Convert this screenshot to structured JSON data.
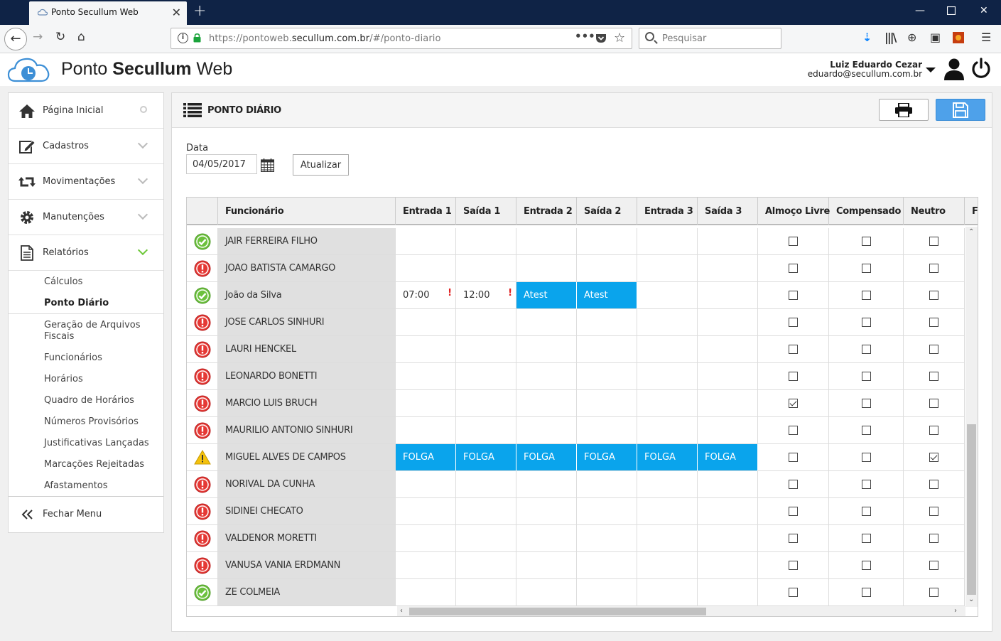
{
  "browser": {
    "tab_title": "Ponto Secullum Web",
    "url_prefix": "https://pontoweb.",
    "url_domain": "secullum.com.br",
    "url_path": "/#/ponto-diario",
    "search_placeholder": "Pesquisar"
  },
  "header": {
    "brand_light": "Ponto ",
    "brand_bold": "Secullum",
    "brand_tail": " Web",
    "user_name": "Luiz Eduardo Cezar",
    "user_email": "eduardo@secullum.com.br"
  },
  "sidebar": {
    "items": [
      {
        "label": "Página Inicial"
      },
      {
        "label": "Cadastros"
      },
      {
        "label": "Movimentações"
      },
      {
        "label": "Manutenções"
      },
      {
        "label": "Relatórios"
      }
    ],
    "sub_items": [
      {
        "label": "Cálculos"
      },
      {
        "label": "Ponto Diário"
      },
      {
        "label": "Geração de Arquivos Fiscais"
      },
      {
        "label": "Funcionários"
      },
      {
        "label": "Horários"
      },
      {
        "label": "Quadro de Horários"
      },
      {
        "label": "Números Provisórios"
      },
      {
        "label": "Justificativas Lançadas"
      },
      {
        "label": "Marcações Rejeitadas"
      },
      {
        "label": "Afastamentos"
      }
    ],
    "close_menu": "Fechar Menu"
  },
  "main": {
    "title": "PONTO DIÁRIO",
    "date_label": "Data",
    "date_value": "04/05/2017",
    "refresh_label": "Atualizar"
  },
  "grid": {
    "columns": [
      "",
      "Funcionário",
      "Entrada 1",
      "Saída 1",
      "Entrada 2",
      "Saída 2",
      "Entrada 3",
      "Saída 3",
      "Almoço Livre",
      "Compensado",
      "Neutro",
      "F"
    ],
    "rows": [
      {
        "status": "ok",
        "name": "JAIR FERREIRA FILHO",
        "cells": [
          "",
          "",
          "",
          "",
          "",
          ""
        ],
        "almoco": false,
        "compensado": false,
        "neutro": false
      },
      {
        "status": "error",
        "name": "JOAO BATISTA CAMARGO",
        "cells": [
          "",
          "",
          "",
          "",
          "",
          ""
        ],
        "almoco": false,
        "compensado": false,
        "neutro": false
      },
      {
        "status": "ok",
        "name": "João da Silva",
        "cells": [
          "07:00",
          "12:00",
          "Atest",
          "Atest",
          "",
          ""
        ],
        "almoco": false,
        "compensado": false,
        "neutro": false
      },
      {
        "status": "error",
        "name": "JOSE CARLOS SINHURI",
        "cells": [
          "",
          "",
          "",
          "",
          "",
          ""
        ],
        "almoco": false,
        "compensado": false,
        "neutro": false
      },
      {
        "status": "error",
        "name": "LAURI HENCKEL",
        "cells": [
          "",
          "",
          "",
          "",
          "",
          ""
        ],
        "almoco": false,
        "compensado": false,
        "neutro": false
      },
      {
        "status": "error",
        "name": "LEONARDO BONETTI",
        "cells": [
          "",
          "",
          "",
          "",
          "",
          ""
        ],
        "almoco": false,
        "compensado": false,
        "neutro": false
      },
      {
        "status": "error",
        "name": "MARCIO LUIS BRUCH",
        "cells": [
          "",
          "",
          "",
          "",
          "",
          ""
        ],
        "almoco": true,
        "compensado": false,
        "neutro": false
      },
      {
        "status": "error",
        "name": "MAURILIO ANTONIO SINHURI",
        "cells": [
          "",
          "",
          "",
          "",
          "",
          ""
        ],
        "almoco": false,
        "compensado": false,
        "neutro": false
      },
      {
        "status": "warning",
        "name": "MIGUEL ALVES DE CAMPOS",
        "cells": [
          "FOLGA",
          "FOLGA",
          "FOLGA",
          "FOLGA",
          "FOLGA",
          "FOLGA"
        ],
        "almoco": false,
        "compensado": false,
        "neutro": true
      },
      {
        "status": "error",
        "name": "NORIVAL DA CUNHA",
        "cells": [
          "",
          "",
          "",
          "",
          "",
          ""
        ],
        "almoco": false,
        "compensado": false,
        "neutro": false
      },
      {
        "status": "error",
        "name": "SIDINEI CHECATO",
        "cells": [
          "",
          "",
          "",
          "",
          "",
          ""
        ],
        "almoco": false,
        "compensado": false,
        "neutro": false
      },
      {
        "status": "error",
        "name": "VALDENOR MORETTI",
        "cells": [
          "",
          "",
          "",
          "",
          "",
          ""
        ],
        "almoco": false,
        "compensado": false,
        "neutro": false
      },
      {
        "status": "error",
        "name": "VANUSA VANIA ERDMANN",
        "cells": [
          "",
          "",
          "",
          "",
          "",
          ""
        ],
        "almoco": false,
        "compensado": false,
        "neutro": false
      },
      {
        "status": "ok",
        "name": "ZE COLMEIA",
        "cells": [
          "",
          "",
          "",
          "",
          "",
          ""
        ],
        "almoco": false,
        "compensado": false,
        "neutro": false
      }
    ],
    "blue_cells": {
      "2": [
        2,
        3
      ],
      "8": [
        0,
        1,
        2,
        3,
        4,
        5
      ]
    },
    "warn_cells": {
      "2": [
        0,
        1
      ]
    }
  },
  "colors": {
    "accent": "#0aa4ec",
    "ok": "#6cc13d",
    "error": "#e53935",
    "warning": "#f4c20d"
  }
}
